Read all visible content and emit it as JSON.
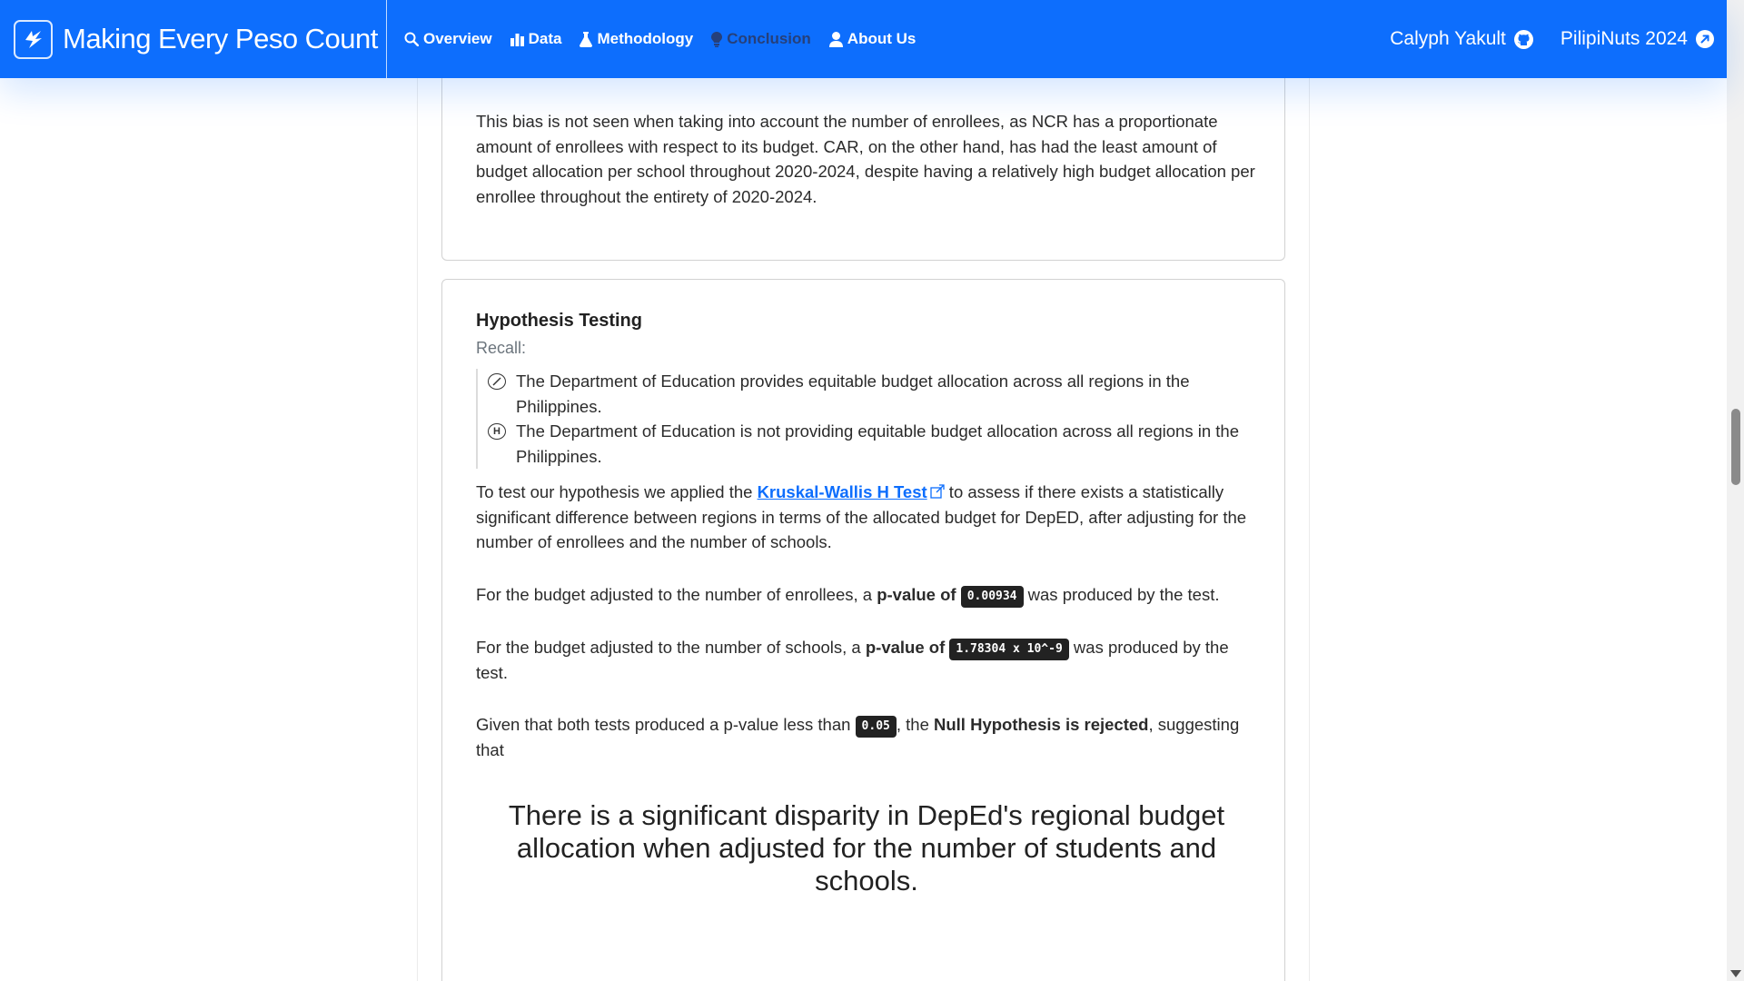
{
  "navbar": {
    "brand_title": "Making Every Peso Count",
    "links": [
      {
        "label": "Overview",
        "icon": "search-icon"
      },
      {
        "label": "Data",
        "icon": "bar-chart-icon"
      },
      {
        "label": "Methodology",
        "icon": "flask-icon"
      },
      {
        "label": "Conclusion",
        "icon": "lightbulb-icon",
        "active": true
      },
      {
        "label": "About Us",
        "icon": "user-icon"
      }
    ],
    "right": [
      {
        "label": "Calyph Yakult",
        "icon": "github-icon"
      },
      {
        "label": "PilipiNuts 2024",
        "icon": "external-arrow-icon"
      }
    ]
  },
  "bias_card": {
    "paragraph": "This bias is not seen when taking into account the number of enrollees, as NCR has a proportionate amount of enrollees with respect to its budget. CAR, on the other hand, has had the least amount of budget allocation per school throughout 2020-2024, despite having a relatively high budget allocation per enrollee throughout the entirety of 2020-2024."
  },
  "hypothesis_card": {
    "title": "Hypothesis Testing",
    "recall": "Recall:",
    "null_hypothesis": "The Department of Education provides equitable budget allocation across all regions in the Philippines.",
    "alt_symbol": "H",
    "alt_hypothesis": "The Department of Education is not providing equitable budget allocation across all regions in the Philippines.",
    "test_intro_before": "To test our hypothesis we applied the ",
    "test_link": "Kruskal-Wallis H Test",
    "test_intro_after": " to assess if there exists a statistically significant difference between regions in terms of the allocated budget for DepED, after adjusting for the number of enrollees and the number of schools.",
    "enrollees_before": "For the budget adjusted to the number of enrollees, a ",
    "pvalue_label": "p-value of",
    "enrollees_pvalue": "0.00934",
    "enrollees_after": " was produced by the test.",
    "schools_before": "For the budget adjusted to the number of schools, a ",
    "schools_pvalue": "1.78304 x 10^-9",
    "schools_after": " was produced by the test.",
    "given_before": "Given that both tests produced a p-value less than ",
    "alpha": "0.05",
    "given_mid": ", the ",
    "rejected": "Null Hypothesis is rejected",
    "given_after": ", suggesting that",
    "conclusion": "There is a significant disparity in DepEd's regional budget allocation when adjusted for the number of students and schools."
  },
  "colors": {
    "navbar": "#0d6efd",
    "active_nav": "#26407a",
    "link": "#0d6efd",
    "code_bg": "#222222"
  }
}
